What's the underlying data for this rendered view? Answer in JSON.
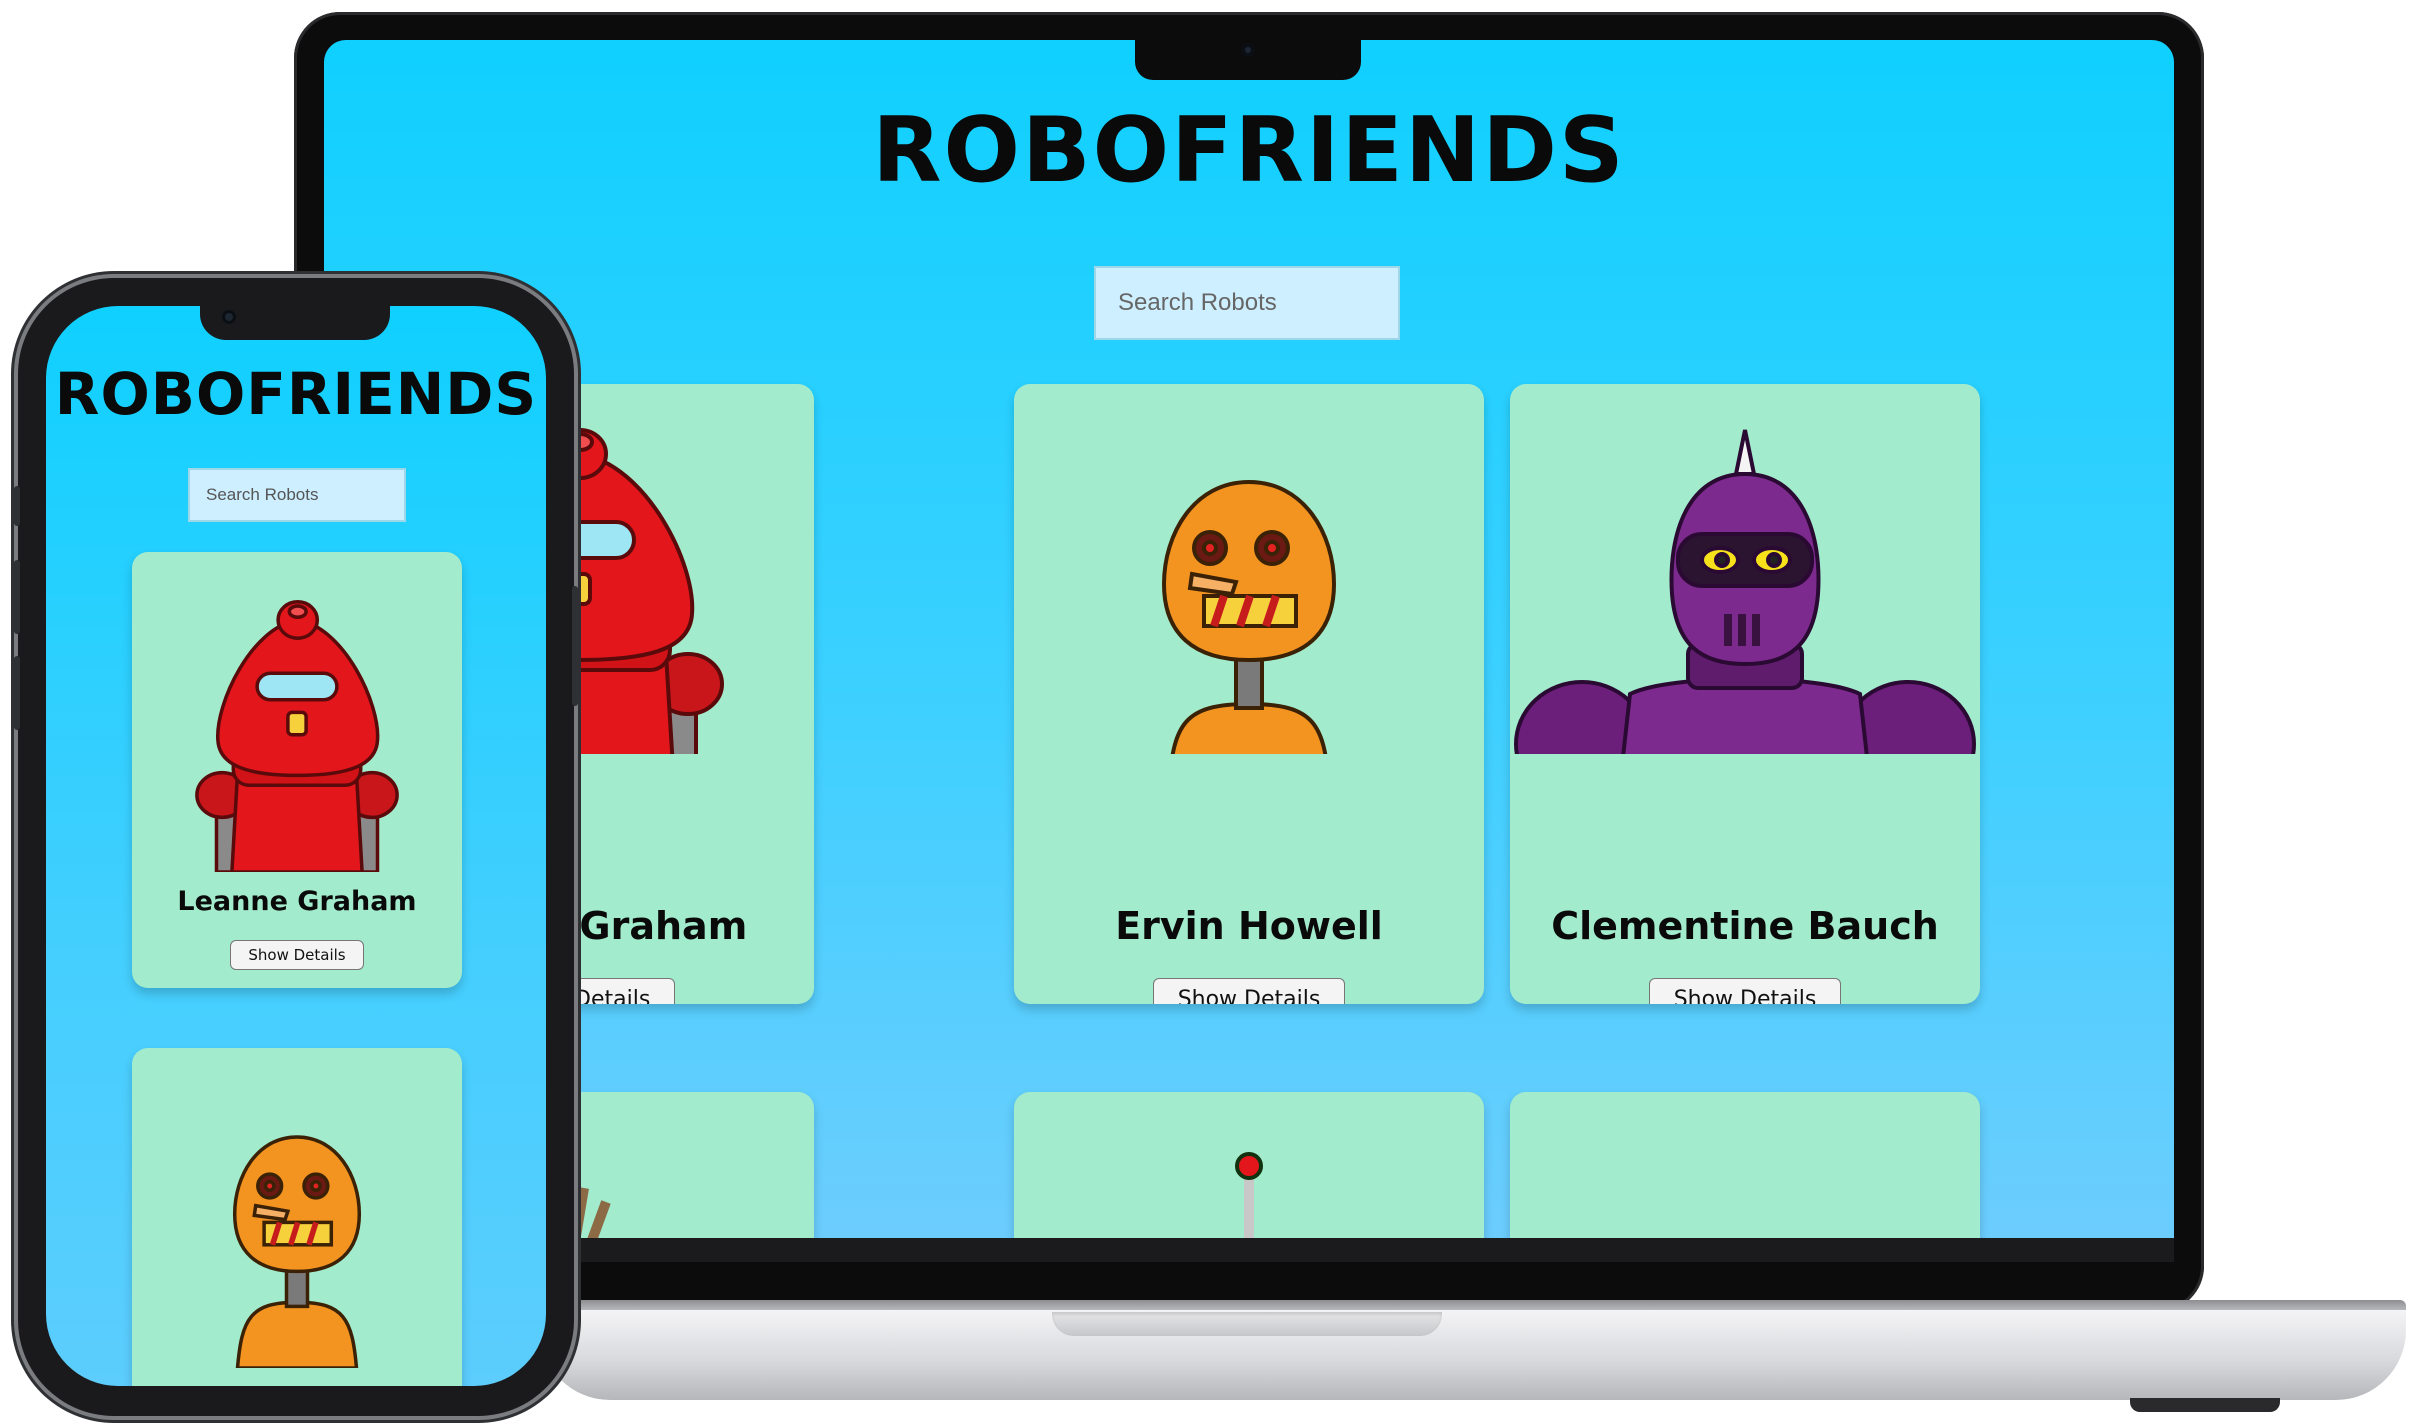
{
  "app": {
    "title": "ROBOFRIENDS",
    "search_placeholder": "Search Robots",
    "button_label": "Show Details"
  },
  "laptop": {
    "cards": [
      {
        "name": "Leanne Graham",
        "robot": "red-robot"
      },
      {
        "name": "Ervin Howell",
        "robot": "orange-robot"
      },
      {
        "name": "Clementine Bauch",
        "robot": "purple-robot"
      },
      {
        "name": "",
        "robot": "purple-robot-partial"
      },
      {
        "name": "",
        "robot": "green-robot-partial"
      },
      {
        "name": "",
        "robot": "orange-robot-partial"
      }
    ]
  },
  "phone": {
    "cards": [
      {
        "name": "Leanne Graham",
        "robot": "red-robot"
      },
      {
        "name": "",
        "robot": "orange-robot"
      }
    ]
  },
  "colors": {
    "background_top": "#0fd0ff",
    "background_bottom": "#6ccdfd",
    "card": "#a2ebcc",
    "search_field": "#cdefff",
    "robot_red": "#e3161c",
    "robot_orange": "#f39421",
    "robot_purple": "#7d2a8f"
  }
}
